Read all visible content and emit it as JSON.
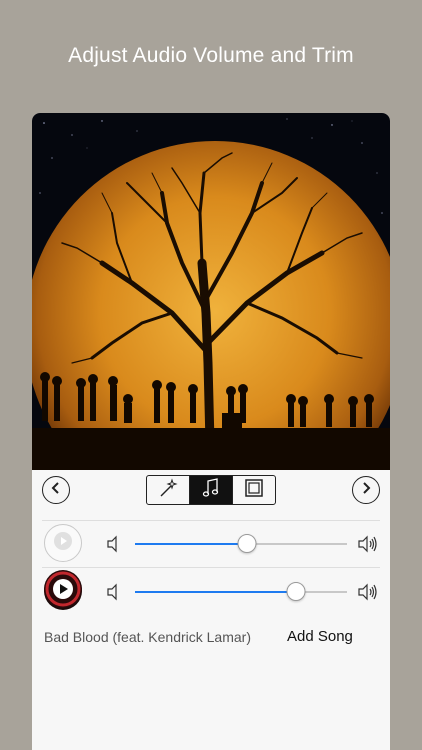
{
  "headline": "Adjust Audio Volume and Trim",
  "toolbar": {
    "prev_icon": "chevron-left-icon",
    "next_icon": "chevron-right-icon",
    "segments": [
      {
        "icon": "magic-wand-icon",
        "active": false
      },
      {
        "icon": "music-note-icon",
        "active": true
      },
      {
        "icon": "frame-icon",
        "active": false
      }
    ]
  },
  "tracks": [
    {
      "name": "video-audio",
      "volume": 0.53
    },
    {
      "name": "song-audio",
      "volume": 0.76
    }
  ],
  "song": {
    "title": "Bad Blood (feat. Kendrick Lamar)",
    "add_label": "Add Song"
  },
  "colors": {
    "background": "#a8a39a",
    "accent": "#1e7bf0",
    "moon": "#d88a1a"
  }
}
